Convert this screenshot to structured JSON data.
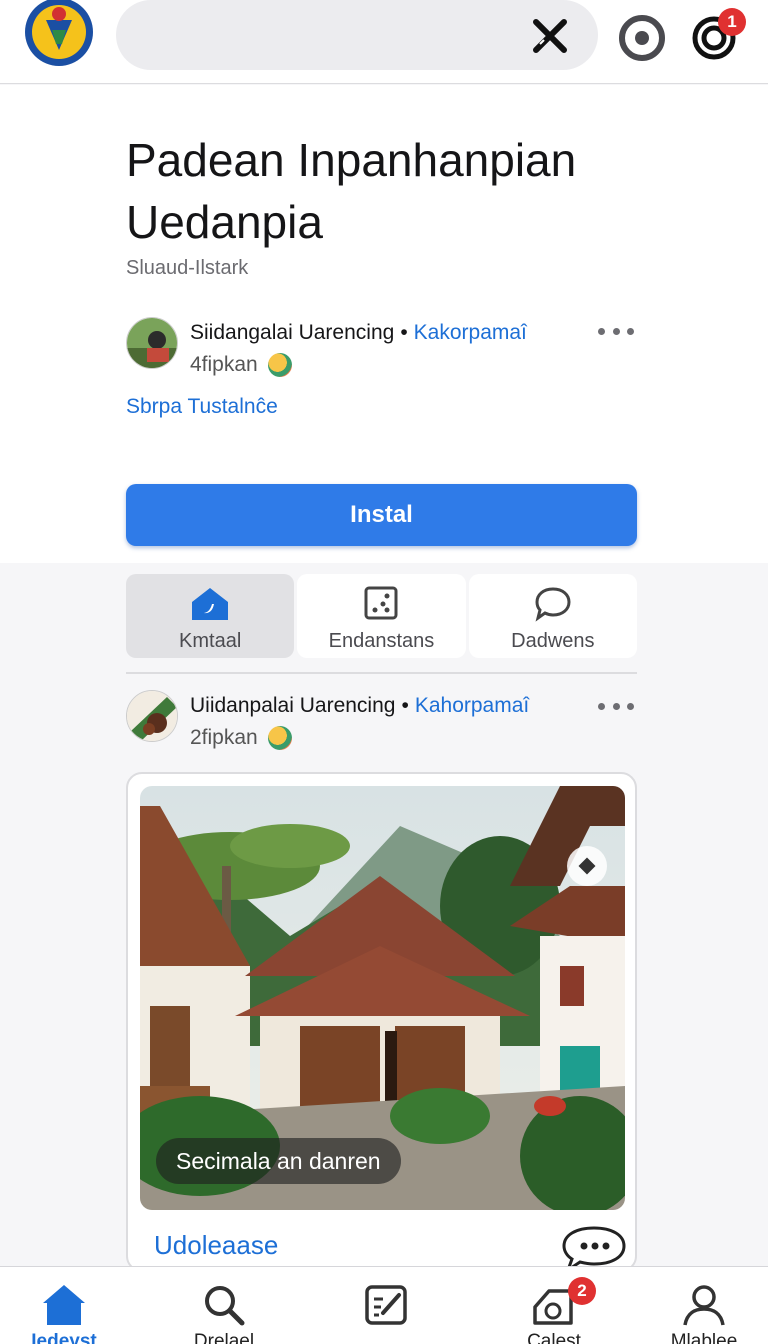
{
  "topbar": {
    "search_placeholder": "",
    "notifications_badge": "1"
  },
  "header": {
    "title_line1": "Padean Inpanhanpian",
    "title_line2": "Uedanpia",
    "subtitle": "Sluaud-Ilstark",
    "author": {
      "name": "Siidangalai Uarencing",
      "separator": "•",
      "group": "Kakorpamaî",
      "meta": "4fipkan"
    },
    "link": "Sbrpa Tustalnĉe",
    "install_label": "Instal"
  },
  "tabs": [
    {
      "label": "Kmtaal",
      "icon": "home-icon",
      "active": true
    },
    {
      "label": "Endanstans",
      "icon": "dice-icon",
      "active": false
    },
    {
      "label": "Dadwens",
      "icon": "chat-icon",
      "active": false
    }
  ],
  "post": {
    "author": {
      "name": "Uiidanpalai Uarencing",
      "separator": "•",
      "group": "Kahorpamaî",
      "meta": "2fipkan"
    },
    "image_caption": "Secimala an danren",
    "link": "Udoleaase"
  },
  "bottom_nav": [
    {
      "label": "Iedeyst",
      "icon": "home-icon",
      "active": true,
      "badge": ""
    },
    {
      "label": "Drelael",
      "icon": "search-icon",
      "active": false,
      "badge": ""
    },
    {
      "label": "",
      "icon": "edit-icon",
      "active": false,
      "badge": ""
    },
    {
      "label": "Calest",
      "icon": "bell-box-icon",
      "active": false,
      "badge": "2"
    },
    {
      "label": "Mlablee",
      "icon": "profile-icon",
      "active": false,
      "badge": ""
    }
  ],
  "colors": {
    "accent": "#2f7be8",
    "link": "#1d6fd6",
    "badge": "#e03131"
  }
}
